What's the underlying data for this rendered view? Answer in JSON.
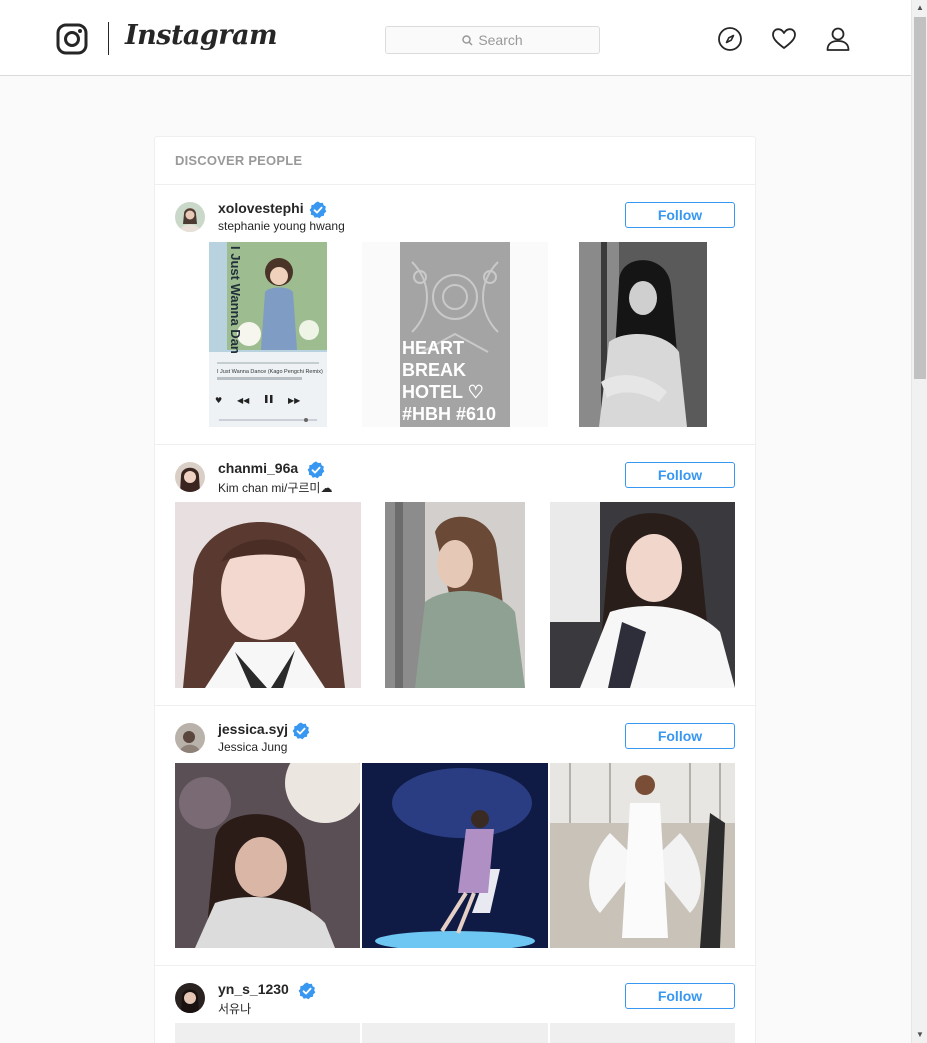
{
  "brand": {
    "wordmark": "Instagram",
    "icon": "instagram-camera-icon"
  },
  "search": {
    "placeholder": "Search",
    "icon": "search-icon"
  },
  "nav_icons": [
    "compass-icon",
    "heart-icon",
    "profile-icon"
  ],
  "discover": {
    "title": "DISCOVER PEOPLE",
    "follow_label": "Follow",
    "people": [
      {
        "username": "xolovestephi",
        "full_name": "stephanie young hwang",
        "verified": true
      },
      {
        "username": "chanmi_96a",
        "full_name": "Kim chan mi/구르미☁",
        "verified": true
      },
      {
        "username": "jessica.syj",
        "full_name": "Jessica Jung",
        "verified": true
      },
      {
        "username": "yn_s_1230",
        "full_name": "서유나",
        "verified": true
      }
    ],
    "photo_text": {
      "album_title": "I Just Wanna Dance",
      "album_track": "I Just Wanna Dance (Kago Pengchi Remix)",
      "poster_lines": [
        "HEART",
        "BREAK",
        "HOTEL ♡",
        "#HBH #610"
      ]
    }
  },
  "colors": {
    "accent": "#3897f0",
    "verified": "#3897f0",
    "border": "#efefef",
    "muted": "#999999"
  }
}
